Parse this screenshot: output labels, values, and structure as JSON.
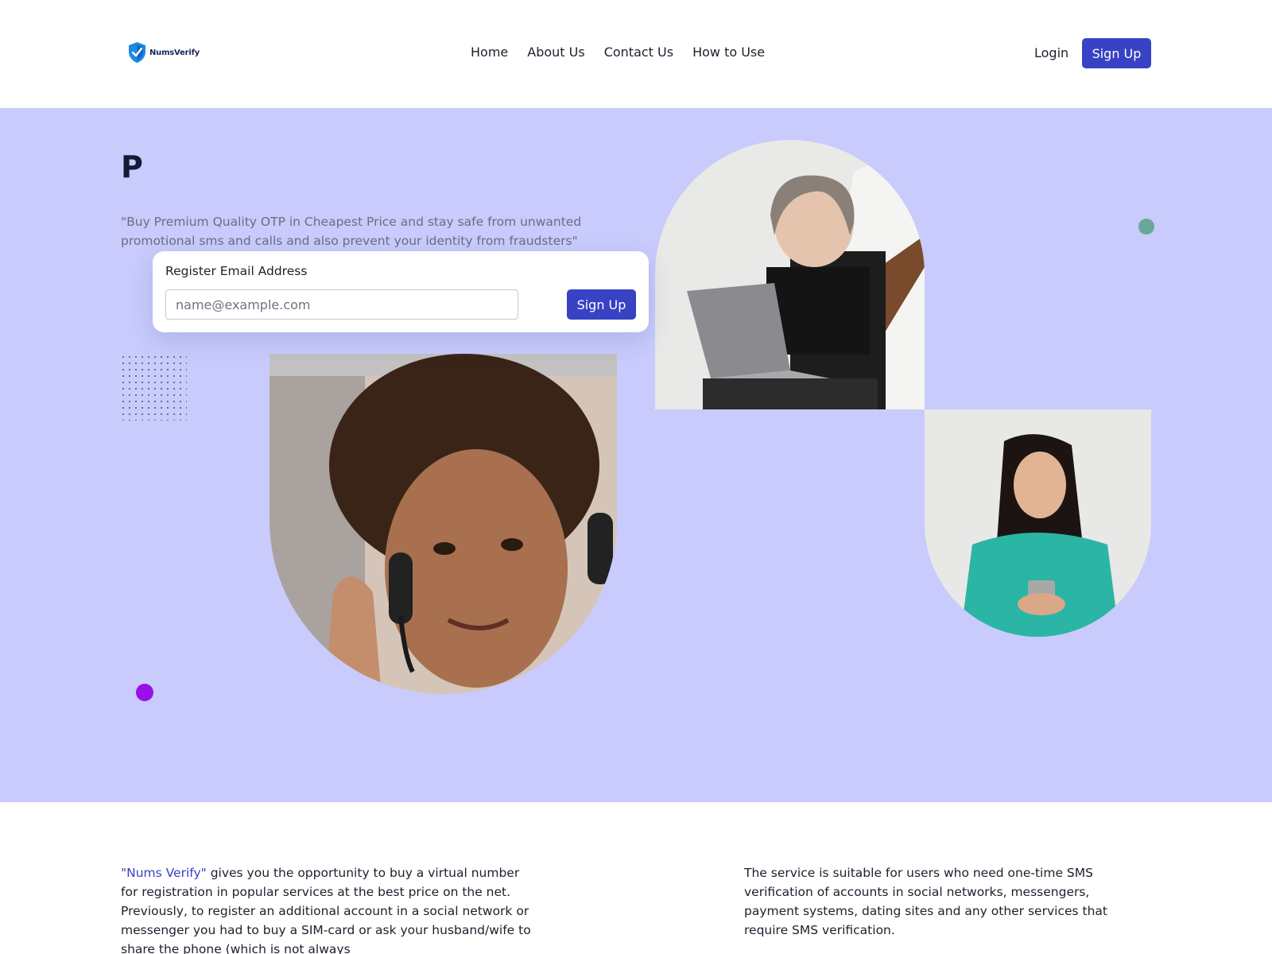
{
  "header": {
    "logo_text": "NumsVerify",
    "nav": [
      "Home",
      "About Us",
      "Contact Us",
      "How to Use"
    ],
    "login_label": "Login",
    "signup_label": "Sign Up"
  },
  "hero": {
    "title": "P",
    "quote": "\"Buy Premium Quality OTP in Cheapest Price and stay safe from unwanted promotional sms and calls and also prevent your identity from fraudsters\"",
    "register": {
      "label": "Register Email Address",
      "placeholder": "name@example.com",
      "value": "",
      "button_label": "Sign Up"
    }
  },
  "info": {
    "left_brand": "\"Nums Verify\"",
    "left_text": " gives you the opportunity to buy a virtual number for registration in popular services at the best price on the net. Previously, to register an additional account in a social network or messenger you had to buy a SIM-card or ask your husband/wife to share the phone (which is not always",
    "right_text": "The service is suitable for users who need one-time SMS verification of accounts in social networks, messengers, payment systems, dating sites and any other services that require SMS verification."
  },
  "colors": {
    "primary": "#3742c4",
    "hero_bg": "#c8cbfb",
    "accent_teal": "#6aa79b",
    "accent_purple": "#9b10e6"
  }
}
